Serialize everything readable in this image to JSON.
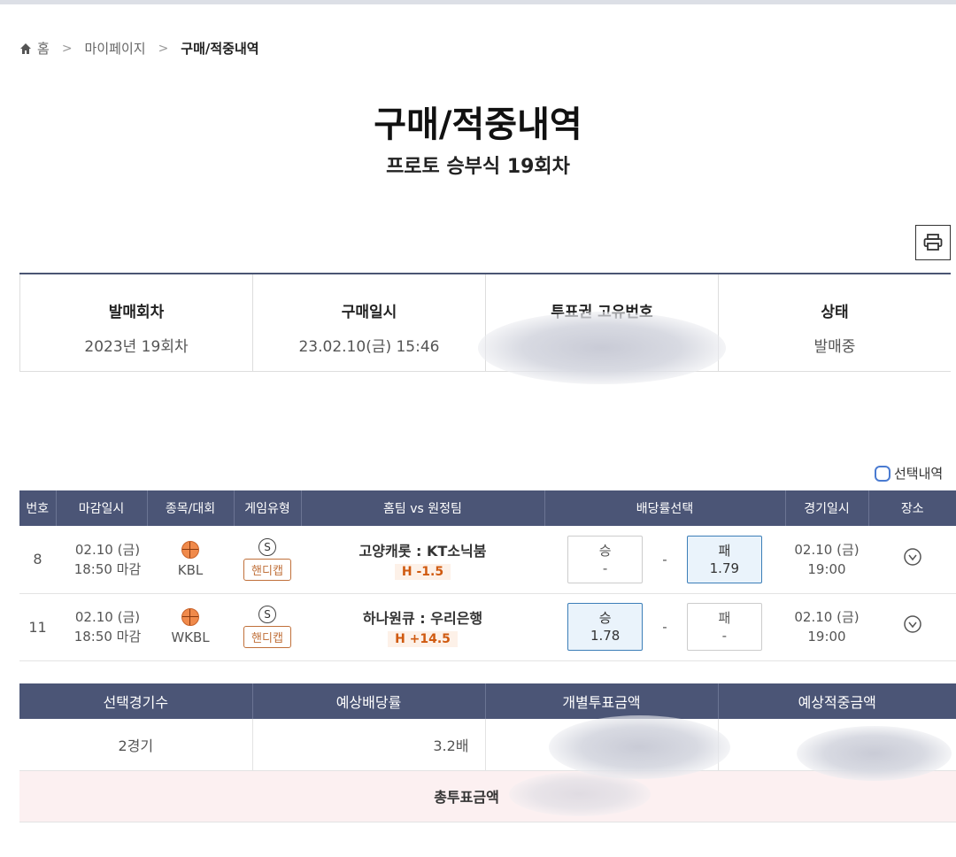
{
  "breadcrumb": {
    "home": "홈",
    "level1": "마이페이지",
    "current": "구매/적중내역"
  },
  "page": {
    "title": "구매/적중내역",
    "subtitle": "프로토 승부식 19회차"
  },
  "info": {
    "round_label": "발매회차",
    "round_value": "2023년 19회차",
    "purchase_label": "구매일시",
    "purchase_value": "23.02.10(금) 15:46",
    "ticket_label": "투표권 고유번호",
    "status_label": "상태",
    "status_value": "발매중"
  },
  "select_toggle_label": "선택내역",
  "games": {
    "headers": [
      "번호",
      "마감일시",
      "종목/대회",
      "게임유형",
      "홈팀 vs 원정팀",
      "배당률선택",
      "경기일시",
      "장소"
    ],
    "rows": [
      {
        "no": "8",
        "deadline_date": "02.10 (금)",
        "deadline_time": "18:50 마감",
        "league": "KBL",
        "type_badge": "S",
        "type_label": "핸디캡",
        "teams": "고양캐롯 : KT소닉붐",
        "handicap": "H -1.5",
        "win_label": "승",
        "win_odds": "-",
        "draw": "-",
        "lose_label": "패",
        "lose_odds": "1.79",
        "selected": "lose",
        "game_date": "02.10 (금)",
        "game_time": "19:00"
      },
      {
        "no": "11",
        "deadline_date": "02.10 (금)",
        "deadline_time": "18:50 마감",
        "league": "WKBL",
        "type_badge": "S",
        "type_label": "핸디캡",
        "teams": "하나원큐 : 우리은행",
        "handicap": "H +14.5",
        "win_label": "승",
        "win_odds": "1.78",
        "draw": "-",
        "lose_label": "패",
        "lose_odds": "-",
        "selected": "win",
        "game_date": "02.10 (금)",
        "game_time": "19:00"
      }
    ]
  },
  "summary": {
    "headers": [
      "선택경기수",
      "예상배당률",
      "개별투표금액",
      "예상적중금액"
    ],
    "games_count": "2경기",
    "expected_odds": "3.2배",
    "total_label": "총투표금액"
  },
  "icons": {
    "home": "home-icon",
    "print": "printer-icon",
    "sport": "basketball-icon",
    "venue": "location-pin-icon"
  }
}
